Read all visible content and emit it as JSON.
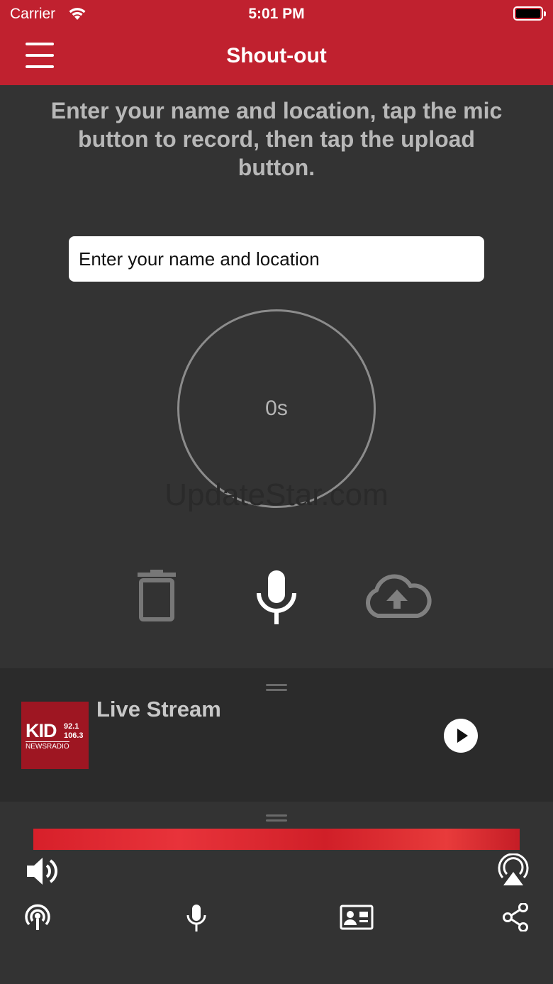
{
  "status_bar": {
    "carrier": "Carrier",
    "time": "5:01 PM"
  },
  "nav": {
    "title": "Shout-out"
  },
  "instructions": "Enter your name and location, tap the mic button to record, then tap the upload button.",
  "name_input": {
    "placeholder": "Enter your name and location"
  },
  "timer": {
    "label": "0s"
  },
  "watermark": "UpdateStar.com",
  "actions": {
    "delete_icon": "trash-icon",
    "record_icon": "microphone-icon",
    "upload_icon": "cloud-upload-icon"
  },
  "player": {
    "title": "Live Stream",
    "logo": {
      "brand": "KID",
      "freq_top": "92.1",
      "freq_bottom": "106.3",
      "tagline": "NEWSRADIO"
    }
  },
  "colors": {
    "brand_red": "#c0212f",
    "background": "#333333",
    "player_bg": "#2b2b2b"
  },
  "bottom_controls": [
    "volume-icon",
    "airplay-icon",
    "podcast-icon",
    "microphone-icon",
    "contact-card-icon",
    "share-icon"
  ]
}
